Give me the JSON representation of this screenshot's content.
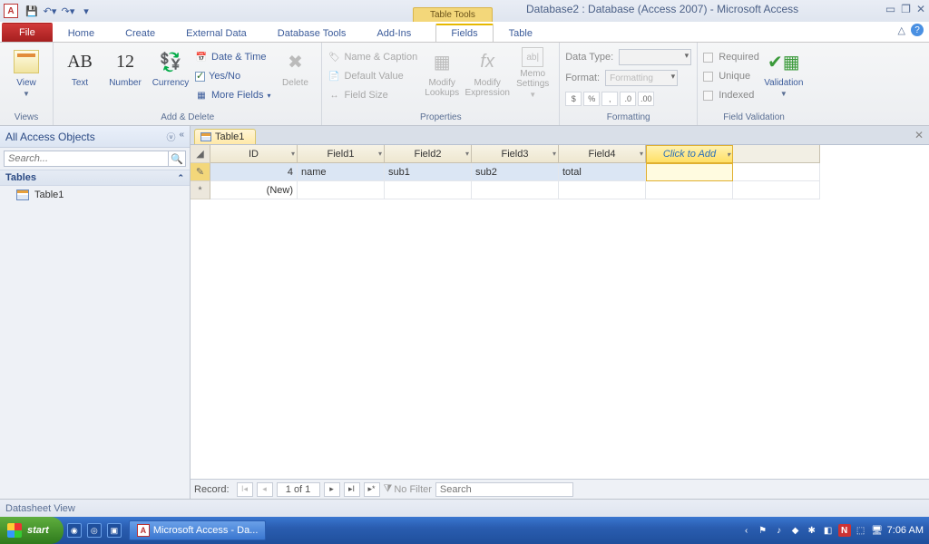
{
  "qat_app_letter": "A",
  "window": {
    "title": "Database2 : Database (Access 2007) - Microsoft Access",
    "context_tab_group": "Table Tools"
  },
  "tabs": {
    "file": "File",
    "home": "Home",
    "create": "Create",
    "external_data": "External Data",
    "database_tools": "Database Tools",
    "addins": "Add-Ins",
    "fields": "Fields",
    "table": "Table"
  },
  "ribbon": {
    "views": {
      "view": "View",
      "group": "Views"
    },
    "add_delete": {
      "text": "Text",
      "number": "Number",
      "currency": "Currency",
      "date_time": "Date & Time",
      "yes_no": "Yes/No",
      "more_fields": "More Fields",
      "delete": "Delete",
      "group": "Add & Delete"
    },
    "properties": {
      "name_caption": "Name & Caption",
      "default_value": "Default Value",
      "field_size": "Field Size",
      "modify_lookups": "Modify Lookups",
      "modify_expression": "Modify Expression",
      "memo_settings": "Memo Settings",
      "group": "Properties"
    },
    "formatting": {
      "data_type": "Data Type:",
      "format": "Format:",
      "format_ph": "Formatting",
      "currency": "$",
      "percent": "%",
      "comma": ",",
      "dec_inc": ".0↑",
      "dec_dec": ".00↓",
      "group": "Formatting"
    },
    "validation": {
      "required": "Required",
      "unique": "Unique",
      "indexed": "Indexed",
      "validation": "Validation",
      "group": "Field Validation"
    }
  },
  "nav": {
    "header": "All Access Objects",
    "search_ph": "Search...",
    "group": "Tables",
    "items": [
      "Table1"
    ]
  },
  "doc": {
    "tab": "Table1"
  },
  "grid": {
    "columns": [
      "ID",
      "Field1",
      "Field2",
      "Field3",
      "Field4"
    ],
    "add_col": "Click to Add",
    "rows": [
      {
        "selector": "✎",
        "ID": "4",
        "Field1": "name",
        "Field2": "sub1",
        "Field3": "sub2",
        "Field4": "total"
      }
    ],
    "new_row": {
      "selector": "*",
      "ID": "(New)"
    }
  },
  "recnav": {
    "label": "Record:",
    "position": "1 of 1",
    "no_filter": "No Filter",
    "search_ph": "Search"
  },
  "status": {
    "view": "Datasheet View"
  },
  "taskbar": {
    "start": "start",
    "task": "Microsoft Access - Da...",
    "clock": "7:06 AM"
  }
}
